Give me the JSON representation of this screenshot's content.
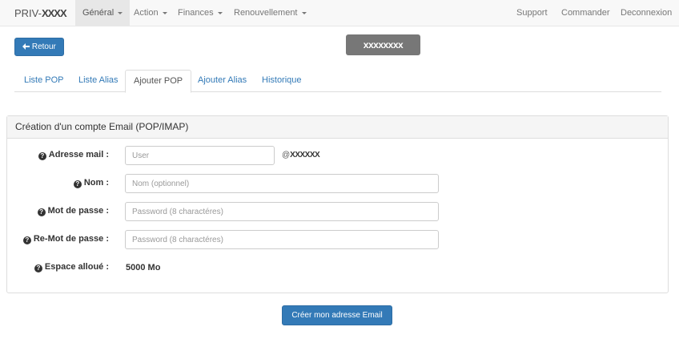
{
  "navbar": {
    "brand_prefix": "PRIV-",
    "brand_masked": "XXXX",
    "items": [
      {
        "label": "Général",
        "dropdown": true,
        "active": true
      },
      {
        "label": "Action",
        "dropdown": true,
        "active": false
      },
      {
        "label": "Finances",
        "dropdown": true,
        "active": false
      },
      {
        "label": "Renouvellement",
        "dropdown": true,
        "active": false
      }
    ],
    "right_items": [
      {
        "label": "Support"
      },
      {
        "label": "Commander"
      },
      {
        "label": "Deconnexion"
      }
    ]
  },
  "back_button": {
    "label": "Retour",
    "icon": "arrow-left-icon"
  },
  "domain_badge": {
    "text": "xxxxxxxx"
  },
  "tabs": [
    {
      "label": "Liste POP",
      "active": false
    },
    {
      "label": "Liste Alias",
      "active": false
    },
    {
      "label": "Ajouter POP",
      "active": true
    },
    {
      "label": "Ajouter Alias",
      "active": false
    },
    {
      "label": "Historique",
      "active": false
    }
  ],
  "panel": {
    "title": "Création d'un compte Email (POP/IMAP)",
    "fields": {
      "email": {
        "label": "Adresse mail :",
        "placeholder": "User",
        "suffix_prefix": "@",
        "suffix_masked": "XXXXXX"
      },
      "name": {
        "label": "Nom :",
        "placeholder": "Nom (optionnel)"
      },
      "password": {
        "label": "Mot de passe :",
        "placeholder": "Password (8 charactéres)"
      },
      "password_confirm": {
        "label": "Re-Mot de passe :",
        "placeholder": "Password (8 charactéres)"
      },
      "quota": {
        "label": "Espace alloué :",
        "value": "5000 Mo"
      }
    }
  },
  "submit_button": {
    "label": "Créer mon adresse Email"
  },
  "colors": {
    "primary": "#337ab7",
    "navbar_bg": "#f8f8f8",
    "badge_bg": "#777777",
    "link": "#337ab7"
  }
}
